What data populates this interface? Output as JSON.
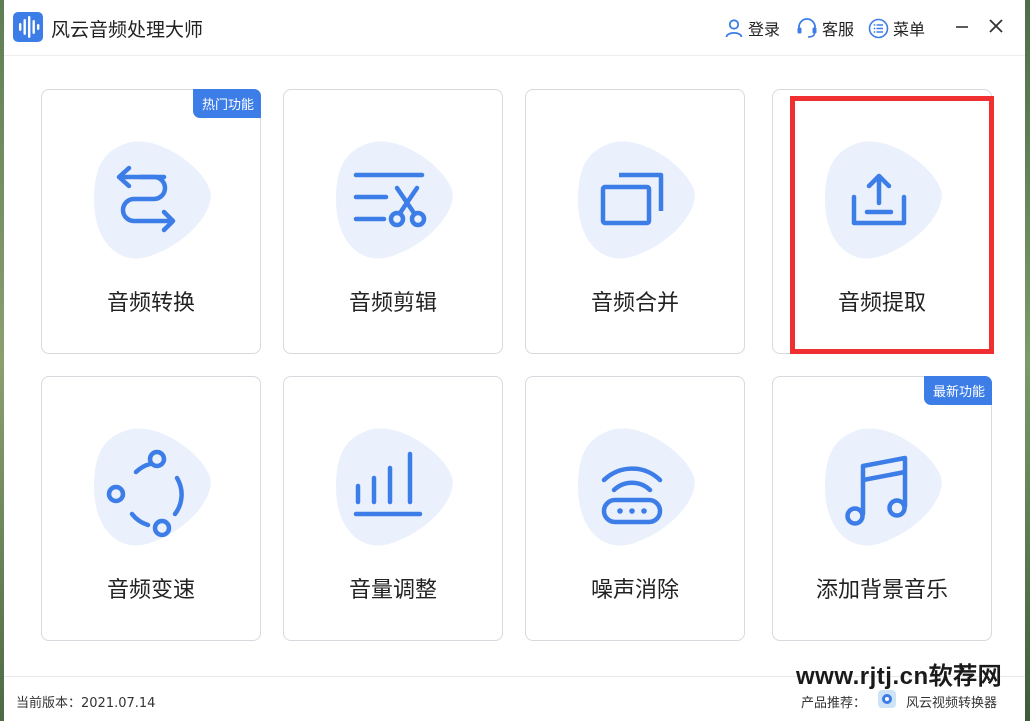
{
  "window": {
    "title": "风云音频处理大师",
    "actions": {
      "login": "登录",
      "support": "客服",
      "menu": "菜单"
    }
  },
  "cards": [
    {
      "label": "音频转换",
      "badge": "热门功能",
      "icon": "convert-arrows-icon"
    },
    {
      "label": "音频剪辑",
      "badge": null,
      "icon": "scissors-icon"
    },
    {
      "label": "音频合并",
      "badge": null,
      "icon": "merge-squares-icon"
    },
    {
      "label": "音频提取",
      "badge": null,
      "icon": "upload-icon"
    },
    {
      "label": "音频变速",
      "badge": null,
      "icon": "orbit-icon"
    },
    {
      "label": "音量调整",
      "badge": null,
      "icon": "volume-bars-icon"
    },
    {
      "label": "噪声消除",
      "badge": null,
      "icon": "router-wave-icon"
    },
    {
      "label": "添加背景音乐",
      "badge": "最新功能",
      "icon": "music-note-icon"
    }
  ],
  "footer": {
    "version": "当前版本：2021.07.14",
    "recommend_label": "产品推荐：",
    "recommend_product": "风云视频转换器"
  },
  "watermark": "www.rjtj.cn软荐网",
  "colors": {
    "accent": "#3d7de8",
    "blob": "#eaf1fc",
    "highlight": "#f03030"
  }
}
